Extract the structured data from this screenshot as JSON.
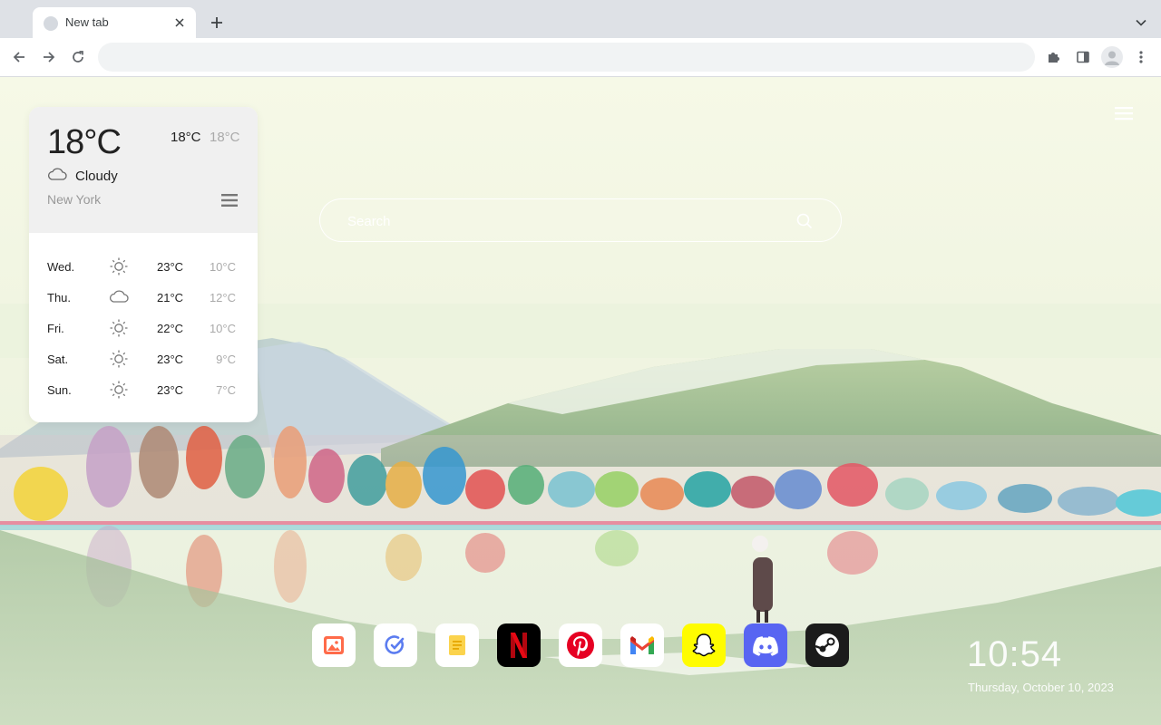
{
  "browser": {
    "tab_title": "New tab",
    "address": ""
  },
  "weather": {
    "current_temp": "18°C",
    "high": "18°C",
    "low": "18°C",
    "condition": "Cloudy",
    "condition_icon": "cloud-icon",
    "city": "New York",
    "forecast": [
      {
        "day": "Wed.",
        "icon": "sun-icon",
        "high": "23°C",
        "low": "10°C"
      },
      {
        "day": "Thu.",
        "icon": "cloud-icon",
        "high": "21°C",
        "low": "12°C"
      },
      {
        "day": "Fri.",
        "icon": "sun-icon",
        "high": "22°C",
        "low": "10°C"
      },
      {
        "day": "Sat.",
        "icon": "sun-icon",
        "high": "23°C",
        "low": "9°C"
      },
      {
        "day": "Sun.",
        "icon": "sun-icon",
        "high": "23°C",
        "low": "7°C"
      }
    ]
  },
  "search": {
    "placeholder": "Search"
  },
  "dock": [
    {
      "name": "gallery",
      "icon": "image-icon",
      "color": "#ff6b4a"
    },
    {
      "name": "todo",
      "icon": "check-circle-icon",
      "color": "#5b7cf0"
    },
    {
      "name": "notes",
      "icon": "note-icon",
      "color": "#f4b400"
    },
    {
      "name": "netflix",
      "icon": "netflix-icon",
      "color": "#e50914"
    },
    {
      "name": "pinterest",
      "icon": "pinterest-icon",
      "color": "#e60023"
    },
    {
      "name": "gmail",
      "icon": "gmail-icon",
      "color": "#ea4335"
    },
    {
      "name": "snapchat",
      "icon": "snapchat-icon",
      "color": "#fffc00"
    },
    {
      "name": "discord",
      "icon": "discord-icon",
      "color": "#5865f2"
    },
    {
      "name": "steam",
      "icon": "steam-icon",
      "color": "#1b1b1b"
    }
  ],
  "clock": {
    "time": "10:54",
    "date": "Thursday, October 10, 2023"
  }
}
